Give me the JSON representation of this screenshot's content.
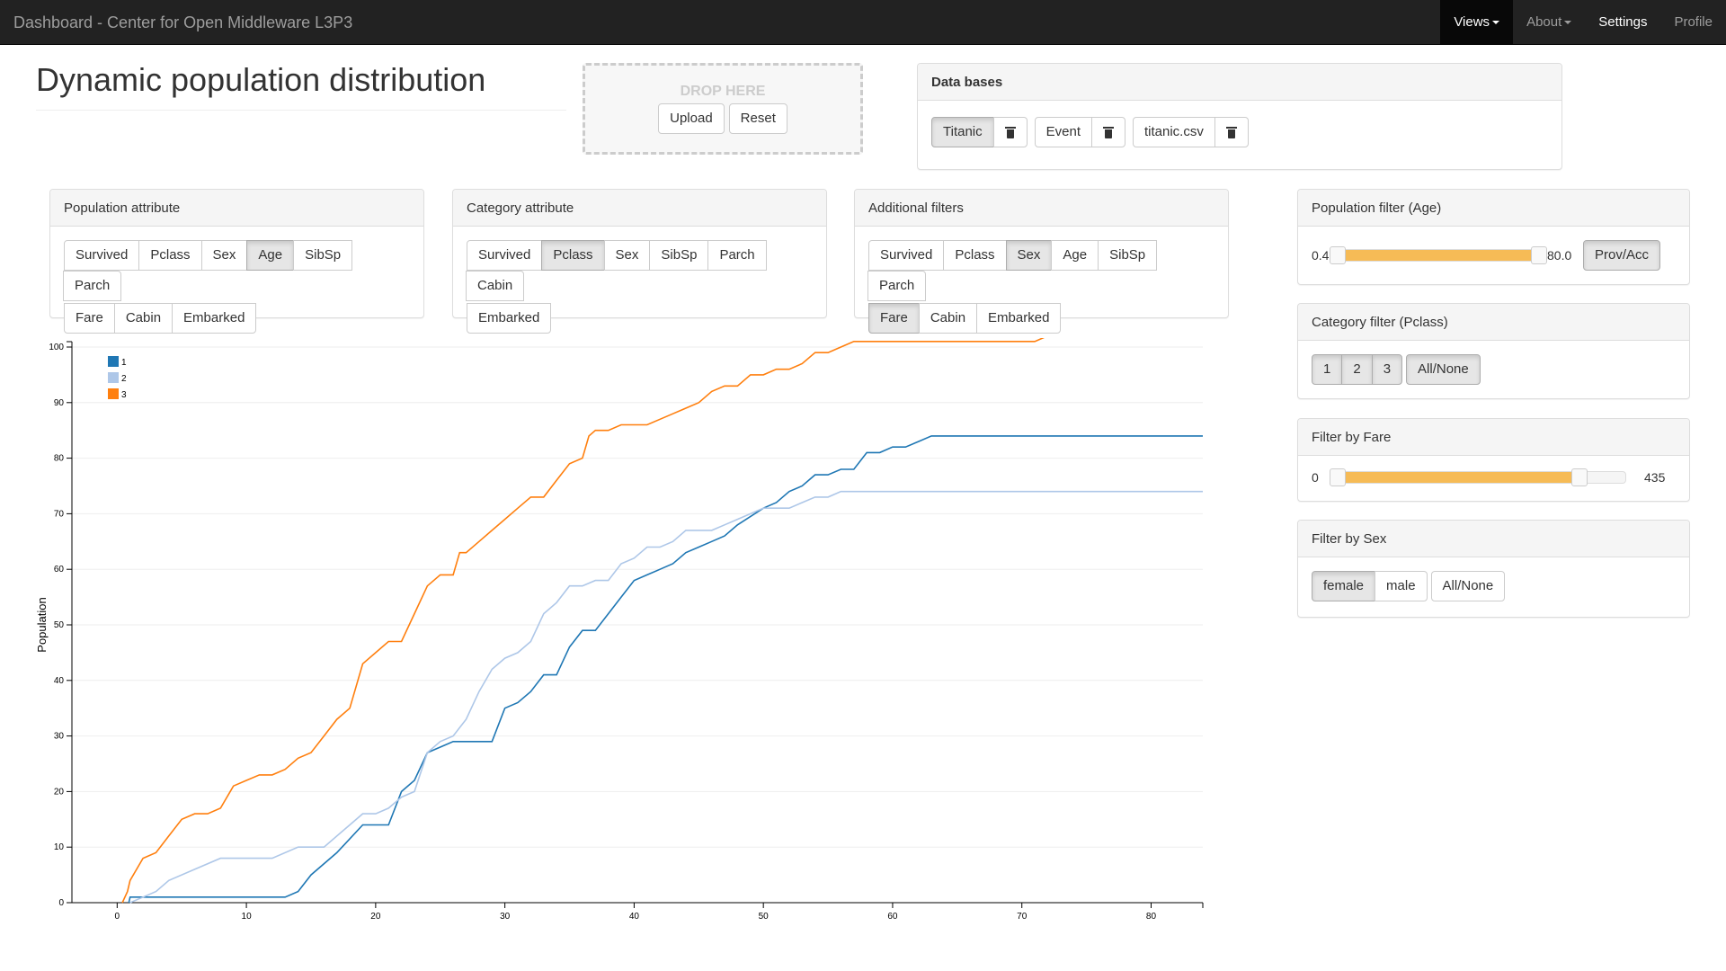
{
  "navbar": {
    "brand": "Dashboard - Center for Open Middleware L3P3",
    "items": [
      "Views",
      "About",
      "Settings",
      "Profile"
    ]
  },
  "page": {
    "title": "Dynamic population distribution"
  },
  "dropzone": {
    "label": "DROP HERE",
    "upload": "Upload",
    "reset": "Reset"
  },
  "databases": {
    "heading": "Data bases",
    "items": [
      "Titanic",
      "Event",
      "titanic.csv"
    ],
    "active": "Titanic"
  },
  "population_attribute": {
    "heading": "Population attribute",
    "buttons": [
      "Survived",
      "Pclass",
      "Sex",
      "Age",
      "SibSp",
      "Parch",
      "Fare",
      "Cabin",
      "Embarked"
    ],
    "active": "Age"
  },
  "category_attribute": {
    "heading": "Category attribute",
    "buttons": [
      "Survived",
      "Pclass",
      "Sex",
      "SibSp",
      "Parch",
      "Cabin",
      "Embarked"
    ],
    "active": "Pclass"
  },
  "additional_filters": {
    "heading": "Additional filters",
    "buttons": [
      "Survived",
      "Pclass",
      "Sex",
      "Age",
      "SibSp",
      "Parch",
      "Fare",
      "Cabin",
      "Embarked"
    ],
    "active": [
      "Sex",
      "Fare"
    ]
  },
  "population_filter": {
    "heading": "Population filter (Age)",
    "min": "0.4",
    "max": "80.0",
    "button": "Prov/Acc",
    "range_fraction": [
      0.0,
      1.0
    ]
  },
  "category_filter": {
    "heading": "Category filter (Pclass)",
    "buttons": [
      "1",
      "2",
      "3"
    ],
    "all_none": "All/None"
  },
  "fare_filter": {
    "heading": "Filter by Fare",
    "min": "0",
    "max": "435",
    "range_fraction": [
      0.0,
      0.84
    ]
  },
  "sex_filter": {
    "heading": "Filter by Sex",
    "buttons": [
      "female",
      "male"
    ],
    "all_none": "All/None",
    "active": "female"
  },
  "colors": {
    "class1": "#1f77b4",
    "class2": "#aec7e8",
    "class3": "#ff7f0e",
    "slider": "#f6bb56"
  },
  "chart_data": {
    "type": "line",
    "ylabel": "Population",
    "xlim": [
      -3.5,
      84
    ],
    "ylim": [
      0,
      100
    ],
    "xticks": [
      0,
      10,
      20,
      30,
      40,
      50,
      60,
      70,
      80
    ],
    "yticks": [
      0,
      10,
      20,
      30,
      40,
      50,
      60,
      70,
      80,
      90,
      100
    ],
    "legend_position": "top-left",
    "series": [
      {
        "name": "1",
        "color": "#1f77b4",
        "points": [
          [
            0.9,
            0
          ],
          [
            1,
            1
          ],
          [
            2,
            1
          ],
          [
            8,
            1
          ],
          [
            13,
            1
          ],
          [
            14,
            2
          ],
          [
            15,
            5
          ],
          [
            17,
            9
          ],
          [
            19,
            14
          ],
          [
            21,
            14
          ],
          [
            22,
            20
          ],
          [
            23,
            22
          ],
          [
            24,
            27
          ],
          [
            25,
            28
          ],
          [
            26,
            29
          ],
          [
            29,
            29
          ],
          [
            30,
            35
          ],
          [
            31,
            36
          ],
          [
            32,
            38
          ],
          [
            33,
            41
          ],
          [
            34,
            41
          ],
          [
            35,
            46
          ],
          [
            36,
            49
          ],
          [
            37,
            49
          ],
          [
            38,
            52
          ],
          [
            39,
            55
          ],
          [
            40,
            58
          ],
          [
            41,
            59
          ],
          [
            42,
            60
          ],
          [
            43,
            61
          ],
          [
            44,
            63
          ],
          [
            45,
            64
          ],
          [
            46,
            65
          ],
          [
            47,
            66
          ],
          [
            48,
            68
          ],
          [
            50,
            71
          ],
          [
            51,
            72
          ],
          [
            52,
            74
          ],
          [
            53,
            75
          ],
          [
            54,
            77
          ],
          [
            55,
            77
          ],
          [
            56,
            78
          ],
          [
            57,
            78
          ],
          [
            58,
            81
          ],
          [
            59,
            81
          ],
          [
            60,
            82
          ],
          [
            61,
            82
          ],
          [
            62,
            83
          ],
          [
            63,
            84
          ],
          [
            84,
            84
          ]
        ]
      },
      {
        "name": "2",
        "color": "#aec7e8",
        "points": [
          [
            1,
            0
          ],
          [
            2,
            1
          ],
          [
            3,
            2
          ],
          [
            4,
            4
          ],
          [
            6,
            6
          ],
          [
            8,
            8
          ],
          [
            12,
            8
          ],
          [
            14,
            10
          ],
          [
            16,
            10
          ],
          [
            18,
            14
          ],
          [
            19,
            16
          ],
          [
            20,
            16
          ],
          [
            21,
            17
          ],
          [
            22,
            19
          ],
          [
            23,
            20
          ],
          [
            24,
            27
          ],
          [
            25,
            29
          ],
          [
            26,
            30
          ],
          [
            27,
            33
          ],
          [
            28,
            38
          ],
          [
            29,
            42
          ],
          [
            30,
            44
          ],
          [
            31,
            45
          ],
          [
            32,
            47
          ],
          [
            33,
            52
          ],
          [
            34,
            54
          ],
          [
            35,
            57
          ],
          [
            36,
            57
          ],
          [
            37,
            58
          ],
          [
            38,
            58
          ],
          [
            39,
            61
          ],
          [
            40,
            62
          ],
          [
            41,
            64
          ],
          [
            42,
            64
          ],
          [
            43,
            65
          ],
          [
            44,
            67
          ],
          [
            45,
            67
          ],
          [
            46,
            67
          ],
          [
            47,
            68
          ],
          [
            48,
            69
          ],
          [
            50,
            71
          ],
          [
            51,
            71
          ],
          [
            52,
            71
          ],
          [
            53,
            72
          ],
          [
            54,
            73
          ],
          [
            55,
            73
          ],
          [
            56,
            74
          ],
          [
            84,
            74
          ]
        ]
      },
      {
        "name": "3",
        "color": "#ff7f0e",
        "points": [
          [
            0.4,
            0
          ],
          [
            0.8,
            2
          ],
          [
            1,
            4
          ],
          [
            2,
            8
          ],
          [
            3,
            9
          ],
          [
            4,
            12
          ],
          [
            5,
            15
          ],
          [
            6,
            16
          ],
          [
            7,
            16
          ],
          [
            8,
            17
          ],
          [
            9,
            21
          ],
          [
            10,
            22
          ],
          [
            11,
            23
          ],
          [
            12,
            23
          ],
          [
            13,
            24
          ],
          [
            14,
            26
          ],
          [
            15,
            27
          ],
          [
            16,
            30
          ],
          [
            17,
            33
          ],
          [
            18,
            35
          ],
          [
            19,
            43
          ],
          [
            20,
            45
          ],
          [
            21,
            47
          ],
          [
            22,
            47
          ],
          [
            23,
            52
          ],
          [
            24,
            57
          ],
          [
            25,
            59
          ],
          [
            26,
            59
          ],
          [
            26.5,
            63
          ],
          [
            27,
            63
          ],
          [
            28,
            65
          ],
          [
            29,
            67
          ],
          [
            30,
            69
          ],
          [
            31,
            71
          ],
          [
            32,
            73
          ],
          [
            33,
            73
          ],
          [
            34,
            76
          ],
          [
            35,
            79
          ],
          [
            36,
            80
          ],
          [
            36.5,
            84
          ],
          [
            37,
            85
          ],
          [
            38,
            85
          ],
          [
            39,
            86
          ],
          [
            40,
            86
          ],
          [
            41,
            86
          ],
          [
            42,
            87
          ],
          [
            43,
            88
          ],
          [
            44,
            89
          ],
          [
            45,
            90
          ],
          [
            46,
            92
          ],
          [
            47,
            93
          ],
          [
            48,
            93
          ],
          [
            49,
            95
          ],
          [
            50,
            95
          ],
          [
            51,
            96
          ],
          [
            52,
            96
          ],
          [
            53,
            97
          ],
          [
            54,
            99
          ],
          [
            55,
            99
          ],
          [
            56,
            100
          ],
          [
            57,
            101
          ],
          [
            70,
            101
          ],
          [
            71,
            101
          ],
          [
            72,
            102
          ],
          [
            84,
            102
          ]
        ]
      }
    ]
  }
}
